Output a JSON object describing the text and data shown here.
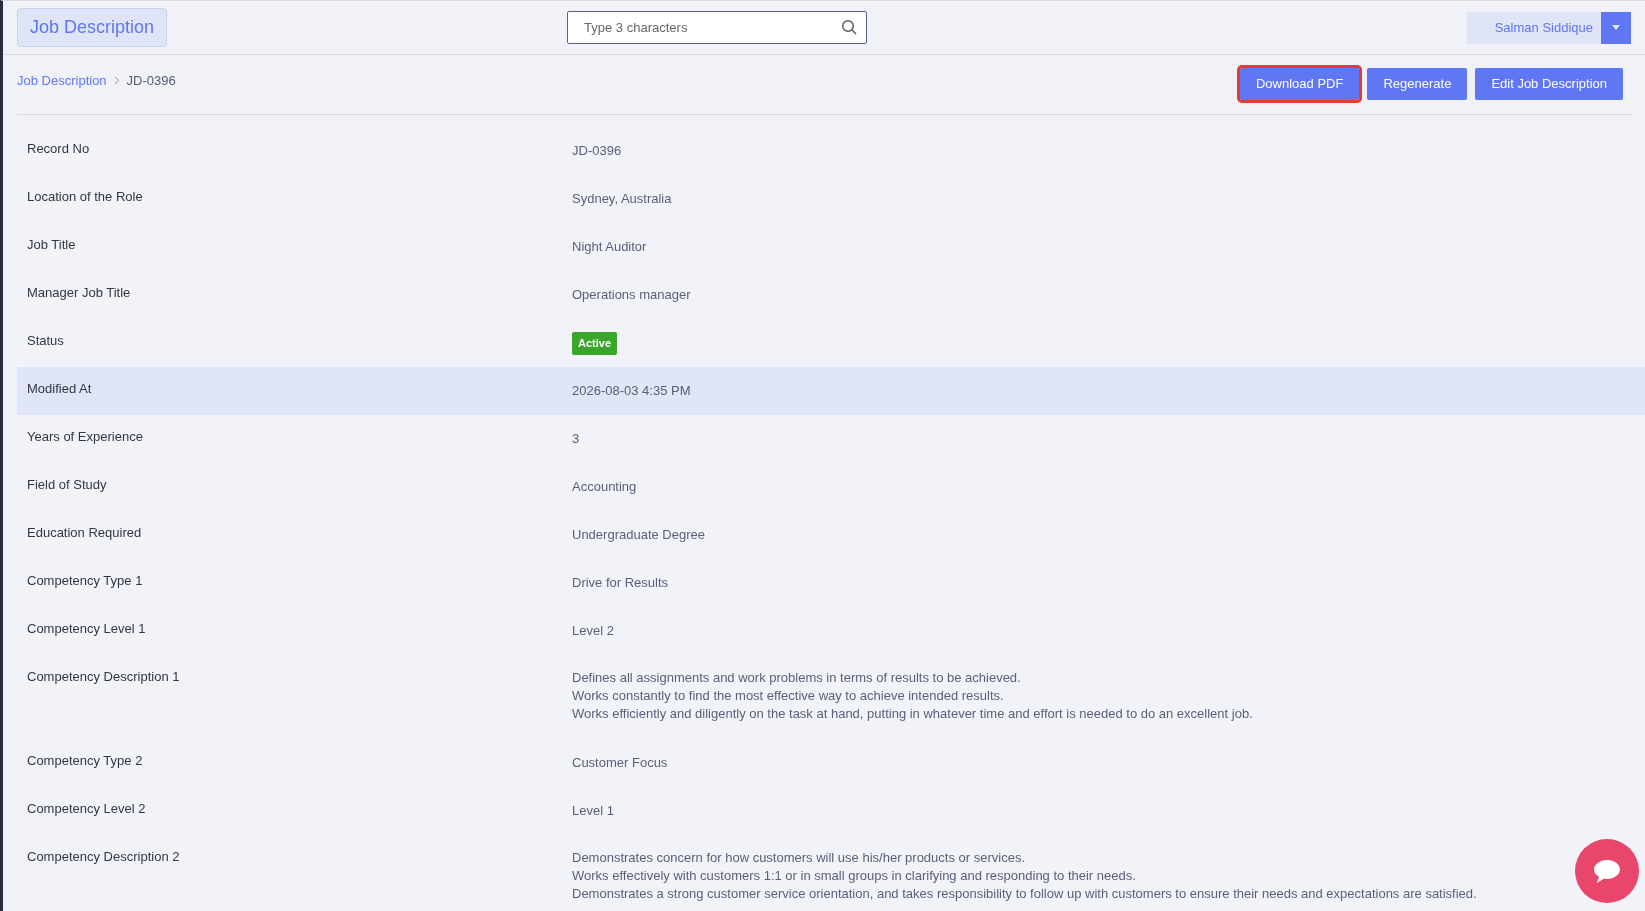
{
  "header": {
    "title": "Job Description",
    "search": {
      "placeholder": "Type 3 characters"
    },
    "user": {
      "name": "Salman Siddique"
    }
  },
  "breadcrumb": [
    {
      "label": "Job Description",
      "kind": "link"
    },
    {
      "label": "JD-0396",
      "kind": "current"
    }
  ],
  "actions": [
    {
      "label": "Download PDF",
      "focused": true
    },
    {
      "label": "Regenerate",
      "focused": false
    },
    {
      "label": "Edit Job Description",
      "focused": false
    }
  ],
  "fields": [
    {
      "label": "Record No",
      "kind": "text",
      "value": "JD-0396",
      "highlighted": false
    },
    {
      "label": "Location of the Role",
      "kind": "text",
      "value": "Sydney, Australia",
      "highlighted": false
    },
    {
      "label": "Job Title",
      "kind": "text",
      "value": "Night Auditor",
      "highlighted": false
    },
    {
      "label": "Manager Job Title",
      "kind": "text",
      "value": "Operations manager",
      "highlighted": false
    },
    {
      "label": "Status",
      "kind": "badge",
      "value": "Active",
      "color": "#3aa52a",
      "highlighted": false
    },
    {
      "label": "Modified At",
      "kind": "text",
      "value": "2026-08-03 4:35 PM",
      "highlighted": true
    },
    {
      "label": "Years of Experience",
      "kind": "text",
      "value": "3",
      "highlighted": false
    },
    {
      "label": "Field of Study",
      "kind": "text",
      "value": "Accounting",
      "highlighted": false
    },
    {
      "label": "Education Required",
      "kind": "text",
      "value": "Undergraduate Degree",
      "highlighted": false
    },
    {
      "label": "Competency Type 1",
      "kind": "text",
      "value": "Drive for Results",
      "highlighted": false
    },
    {
      "label": "Competency Level 1",
      "kind": "text",
      "value": "Level 2",
      "highlighted": false
    },
    {
      "label": "Competency Description 1",
      "kind": "lines",
      "lines": [
        "Defines all assignments and work problems in terms of results to be achieved.",
        "Works constantly to find the most effective way to achieve intended results.",
        "Works efficiently and diligently on the task at hand, putting in whatever time and effort is needed to do an excellent job."
      ],
      "highlighted": false
    },
    {
      "label": "Competency Type 2",
      "kind": "text",
      "value": "Customer Focus",
      "highlighted": false
    },
    {
      "label": "Competency Level 2",
      "kind": "text",
      "value": "Level 1",
      "highlighted": false
    },
    {
      "label": "Competency Description 2",
      "kind": "lines",
      "lines": [
        "Demonstrates concern for how customers will use his/her products or services.",
        "Works effectively with customers 1:1 or in small groups in clarifying and responding to their needs.",
        "Demonstrates a strong customer service orientation, and takes responsibility to follow up with customers to ensure their needs and expectations are satisfied."
      ],
      "highlighted": false
    }
  ]
}
